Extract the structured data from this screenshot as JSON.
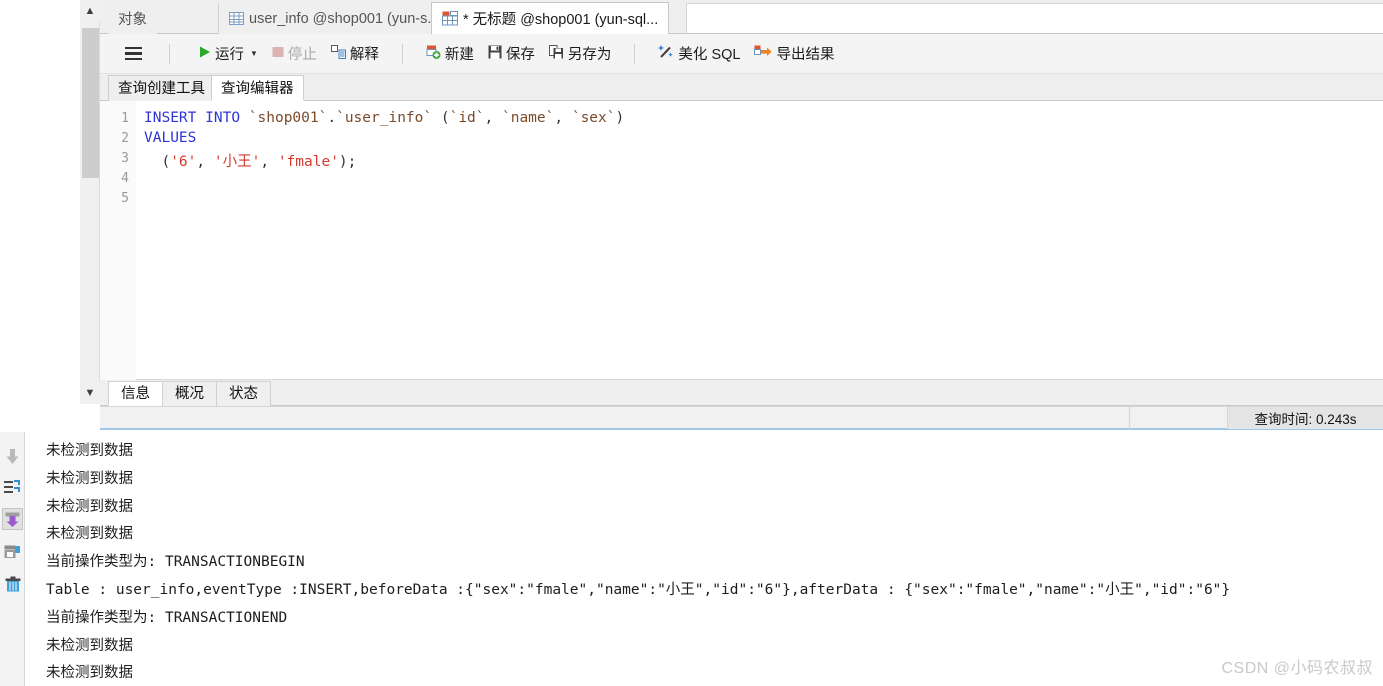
{
  "tabs": {
    "items": [
      {
        "label": "对象",
        "icon": "none",
        "active": false
      },
      {
        "label": "user_info @shop001 (yun-s...",
        "icon": "grid-icon",
        "active": false
      },
      {
        "label": "* 无标题 @shop001 (yun-sql...",
        "icon": "table-new-icon",
        "active": true
      }
    ]
  },
  "toolbar": {
    "menu_icon": "hamburger-icon",
    "run_label": "运行",
    "stop_label": "停止",
    "explain_label": "解释",
    "new_label": "新建",
    "save_label": "保存",
    "save_as_label": "另存为",
    "beautify_label": "美化 SQL",
    "export_label": "导出结果"
  },
  "subtabs": {
    "items": [
      {
        "label": "查询创建工具",
        "active": false
      },
      {
        "label": "查询编辑器",
        "active": true
      }
    ]
  },
  "editor": {
    "line_numbers": [
      "1",
      "2",
      "3",
      "4",
      "5"
    ],
    "lines": [
      {
        "n": 1,
        "text": "INSERT INTO `shop001`.`user_info` (`id`, `name`, `sex`)"
      },
      {
        "n": 2,
        "text": "VALUES"
      },
      {
        "n": 3,
        "text": "  ('6', '小王', 'fmale');"
      },
      {
        "n": 4,
        "text": ""
      },
      {
        "n": 5,
        "text": ""
      }
    ],
    "tokens": {
      "kw_insert": "INSERT",
      "kw_into": "INTO",
      "kw_values": "VALUES",
      "db_name": "`shop001`",
      "table_name": "`user_info`",
      "col_id": "`id`",
      "col_name": "`name`",
      "col_sex": "`sex`",
      "val_id": "'6'",
      "val_name": "'小王'",
      "val_sex": "'fmale'"
    }
  },
  "result_tabs": {
    "items": [
      {
        "label": "信息",
        "active": true
      },
      {
        "label": "概况",
        "active": false
      },
      {
        "label": "状态",
        "active": false
      }
    ]
  },
  "statusbar": {
    "query_time": "查询时间: 0.243s"
  },
  "console": {
    "sidebar_icons": [
      "download-arrow-icon",
      "sync-list-icon",
      "save-down-icon",
      "print-save-icon",
      "trash-icon"
    ],
    "lines": [
      "未检测到数据",
      "未检测到数据",
      "未检测到数据",
      "未检测到数据",
      "当前操作类型为: TRANSACTIONBEGIN",
      "Table : user_info,eventType :INSERT,beforeData :{\"sex\":\"fmale\",\"name\":\"小王\",\"id\":\"6\"},afterData : {\"sex\":\"fmale\",\"name\":\"小王\",\"id\":\"6\"}",
      "当前操作类型为: TRANSACTIONEND",
      "未检测到数据",
      "未检测到数据"
    ]
  },
  "watermark": {
    "text": "CSDN @小码农叔叔"
  },
  "colors": {
    "accent": "#7ec2f0",
    "keyword": "#2e34d8",
    "string": "#d23b2e",
    "backtick": "#7b4b2a",
    "toolbar_bg": "#f4f4f4"
  }
}
